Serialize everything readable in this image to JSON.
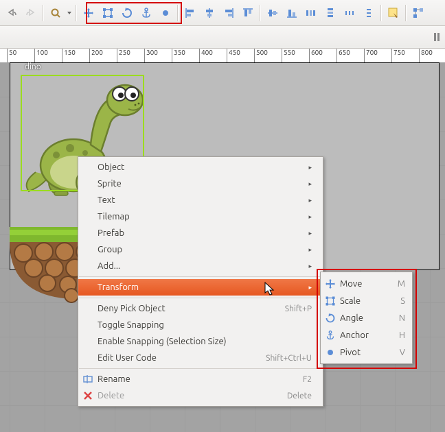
{
  "toolbar": {
    "buttons": [
      "undo",
      "redo",
      "zoom",
      "fit"
    ],
    "transform_tools": [
      "move",
      "scale",
      "angle",
      "anchor",
      "pivot"
    ],
    "align_tools": [
      "align-left",
      "align-center-h",
      "align-right",
      "align-top",
      "align-center-v",
      "align-bottom"
    ],
    "distribute_tools": [
      "dist-left",
      "dist-center-h",
      "dist-right",
      "dist-top",
      "dist-center-v",
      "dist-bottom"
    ],
    "right_tools": [
      "edit-sprite",
      "layers-tree"
    ]
  },
  "ruler": {
    "ticks": [
      50,
      100,
      150,
      200,
      250,
      300,
      350,
      400,
      450,
      500,
      550,
      600,
      650,
      700,
      750,
      800
    ]
  },
  "object": {
    "label": "dino"
  },
  "context_menu": {
    "items": [
      {
        "label": "Object",
        "submenu": true
      },
      {
        "label": "Sprite",
        "submenu": true
      },
      {
        "label": "Text",
        "submenu": true
      },
      {
        "label": "Tilemap",
        "submenu": true
      },
      {
        "label": "Prefab",
        "submenu": true
      },
      {
        "label": "Group",
        "submenu": true
      },
      {
        "label": "Add...",
        "submenu": true
      }
    ],
    "transform_label": "Transform",
    "items2": [
      {
        "label": "Deny Pick Object",
        "shortcut": "Shift+P"
      },
      {
        "label": "Toggle Snapping",
        "shortcut": ""
      },
      {
        "label": "Enable Snapping (Selection Size)",
        "shortcut": ""
      },
      {
        "label": "Edit User Code",
        "shortcut": "Shift+Ctrl+U"
      }
    ],
    "items3": [
      {
        "label": "Rename",
        "shortcut": "F2",
        "icon": "rename"
      },
      {
        "label": "Delete",
        "shortcut": "Delete",
        "icon": "delete",
        "disabled": true
      }
    ]
  },
  "submenu": {
    "items": [
      {
        "label": "Move",
        "key": "M",
        "icon": "move"
      },
      {
        "label": "Scale",
        "key": "S",
        "icon": "scale"
      },
      {
        "label": "Angle",
        "key": "N",
        "icon": "angle"
      },
      {
        "label": "Anchor",
        "key": "H",
        "icon": "anchor"
      },
      {
        "label": "Pivot",
        "key": "V",
        "icon": "pivot"
      }
    ]
  },
  "colors": {
    "highlight_red": "#d40000",
    "selection_green": "#9bdc1f",
    "menu_orange": "#e96131"
  }
}
